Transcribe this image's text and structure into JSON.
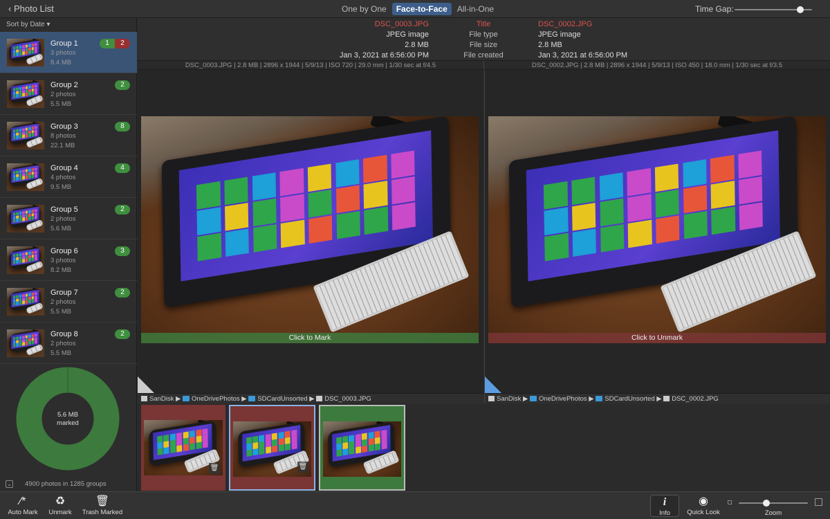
{
  "topbar": {
    "back_label": "Photo List",
    "modes": [
      "One by One",
      "Face-to-Face",
      "All-in-One"
    ],
    "active_mode": "Face-to-Face",
    "time_gap_label": "Time Gap:",
    "time_gap_value": 0.85
  },
  "sidebar": {
    "sort_label": "Sort by Date ▾",
    "groups": [
      {
        "name": "Group 1",
        "photos": "3 photos",
        "size": "8.4 MB",
        "badges": [
          "1",
          "2"
        ]
      },
      {
        "name": "Group 2",
        "photos": "2 photos",
        "size": "5.5 MB",
        "badges": [
          "2"
        ]
      },
      {
        "name": "Group 3",
        "photos": "8 photos",
        "size": "22.1 MB",
        "badges": [
          "8"
        ]
      },
      {
        "name": "Group 4",
        "photos": "4 photos",
        "size": "9.5 MB",
        "badges": [
          "4"
        ]
      },
      {
        "name": "Group 5",
        "photos": "2 photos",
        "size": "5.6 MB",
        "badges": [
          "2"
        ]
      },
      {
        "name": "Group 6",
        "photos": "3 photos",
        "size": "8.2 MB",
        "badges": [
          "3"
        ]
      },
      {
        "name": "Group 7",
        "photos": "2 photos",
        "size": "5.5 MB",
        "badges": [
          "2"
        ]
      },
      {
        "name": "Group 8",
        "photos": "2 photos",
        "size": "5.5 MB",
        "badges": [
          "2"
        ]
      }
    ],
    "donut_line1": "5.6 MB",
    "donut_line2": "marked",
    "donut_marked_fraction": 1.0,
    "footer": "4900 photos in 1285 groups"
  },
  "compare": {
    "labels": [
      "Title",
      "File type",
      "File size",
      "File created"
    ],
    "left": {
      "values": [
        "DSC_0003.JPG",
        "JPEG image",
        "2.8 MB",
        "Jan 3, 2021 at 6:56:00 PM"
      ],
      "exif": "DSC_0003.JPG  |  2.8 MB  |  2896 x 1944  |  5/9/13  |  ISO 720  |  29.0 mm  |  1/30 sec at f/4.5",
      "mark_label": "Click to Mark",
      "path": [
        "SanDisk",
        "OneDrivePhotos",
        "SDCardUnsorted",
        "DSC_0003.JPG"
      ]
    },
    "right": {
      "values": [
        "DSC_0002.JPG",
        "JPEG image",
        "2.8 MB",
        "Jan 3, 2021 at 6:56:00 PM"
      ],
      "exif": "DSC_0002.JPG  |  2.8 MB  |  2896 x 1944  |  5/9/13  |  ISO 450  |  18.0 mm  |  1/30 sec at f/3.5",
      "mark_label": "Click to Unmark",
      "path": [
        "SanDisk",
        "OneDrivePhotos",
        "SDCardUnsorted",
        "DSC_0002.JPG"
      ]
    }
  },
  "colors": {
    "marked_red": "#7a3535",
    "unmarked_green": "#3d7a3d",
    "accent": "#3d5e8a",
    "title_red": "#d9534f"
  },
  "toolbar": {
    "auto_mark": "Auto Mark",
    "unmark": "Unmark",
    "trash_marked": "Trash Marked",
    "info": "Info",
    "quick_look": "Quick Look",
    "zoom": "Zoom",
    "zoom_value": 0.4
  }
}
